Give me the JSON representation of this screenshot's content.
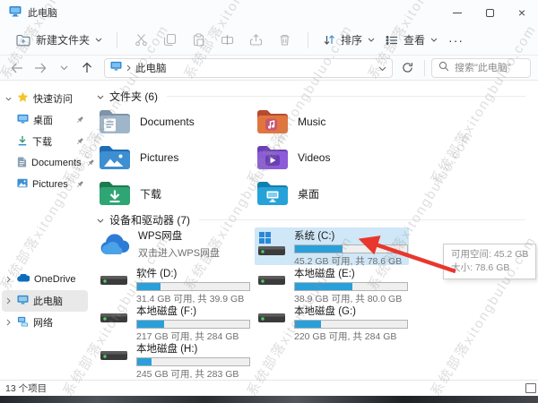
{
  "window": {
    "title": "此电脑"
  },
  "toolbar": {
    "new_folder": "新建文件夹",
    "sort": "排序",
    "view": "查看",
    "more": "···"
  },
  "address": {
    "root": "此电脑",
    "search_placeholder": "搜索\"此电脑\""
  },
  "sidebar": {
    "quick_access_label": "快速访问",
    "pinned": [
      {
        "label": "桌面"
      },
      {
        "label": "下载"
      },
      {
        "label": "Documents"
      },
      {
        "label": "Pictures"
      }
    ],
    "roots": [
      {
        "label": "OneDrive"
      },
      {
        "label": "此电脑",
        "selected": true
      },
      {
        "label": "网络"
      }
    ]
  },
  "main": {
    "folders_header": "文件夹 (6)",
    "folders": [
      {
        "name": "Documents",
        "color": "#9fb6c9"
      },
      {
        "name": "Music",
        "color": "#e0763e"
      },
      {
        "name": "Pictures",
        "color": "#3d8fd1"
      },
      {
        "name": "Videos",
        "color": "#8c5bd8"
      },
      {
        "name": "下载",
        "color": "#2fa573"
      },
      {
        "name": "桌面",
        "color": "#26a2d8"
      }
    ],
    "devices_header": "设备和驱动器 (7)",
    "devices": {
      "wps": {
        "name": "WPS网盘",
        "subtitle": "双击进入WPS网盘"
      },
      "drives": [
        {
          "name": "系统 (C:)",
          "info": "45.2 GB 可用, 共 78.6 GB",
          "used_pct": 42,
          "selected": true
        },
        {
          "name": "软件 (D:)",
          "info": "31.4 GB 可用, 共 39.9 GB",
          "used_pct": 21
        },
        {
          "name": "本地磁盘 (E:)",
          "info": "38.9 GB 可用, 共 80.0 GB",
          "used_pct": 51
        },
        {
          "name": "本地磁盘 (F:)",
          "info": "217 GB 可用, 共 284 GB",
          "used_pct": 24
        },
        {
          "name": "本地磁盘 (G:)",
          "info": "220 GB 可用, 共 284 GB",
          "used_pct": 23
        },
        {
          "name": "本地磁盘 (H:)",
          "info": "245 GB 可用, 共 283 GB",
          "used_pct": 13
        }
      ]
    }
  },
  "tooltip": {
    "line1": "可用空间: 45.2 GB",
    "line2": "大小: 78.6 GB"
  },
  "statusbar": {
    "items_text": "13 个项目"
  },
  "watermark": {
    "text": "系统部落xitongbuluo.com"
  },
  "colors": {
    "accent_blue": "#2b88d8",
    "bar_fill": "#29a0da",
    "selection": "#cfe7f7",
    "arrow_red": "#e8372d",
    "star_yellow": "#f5c42c"
  }
}
